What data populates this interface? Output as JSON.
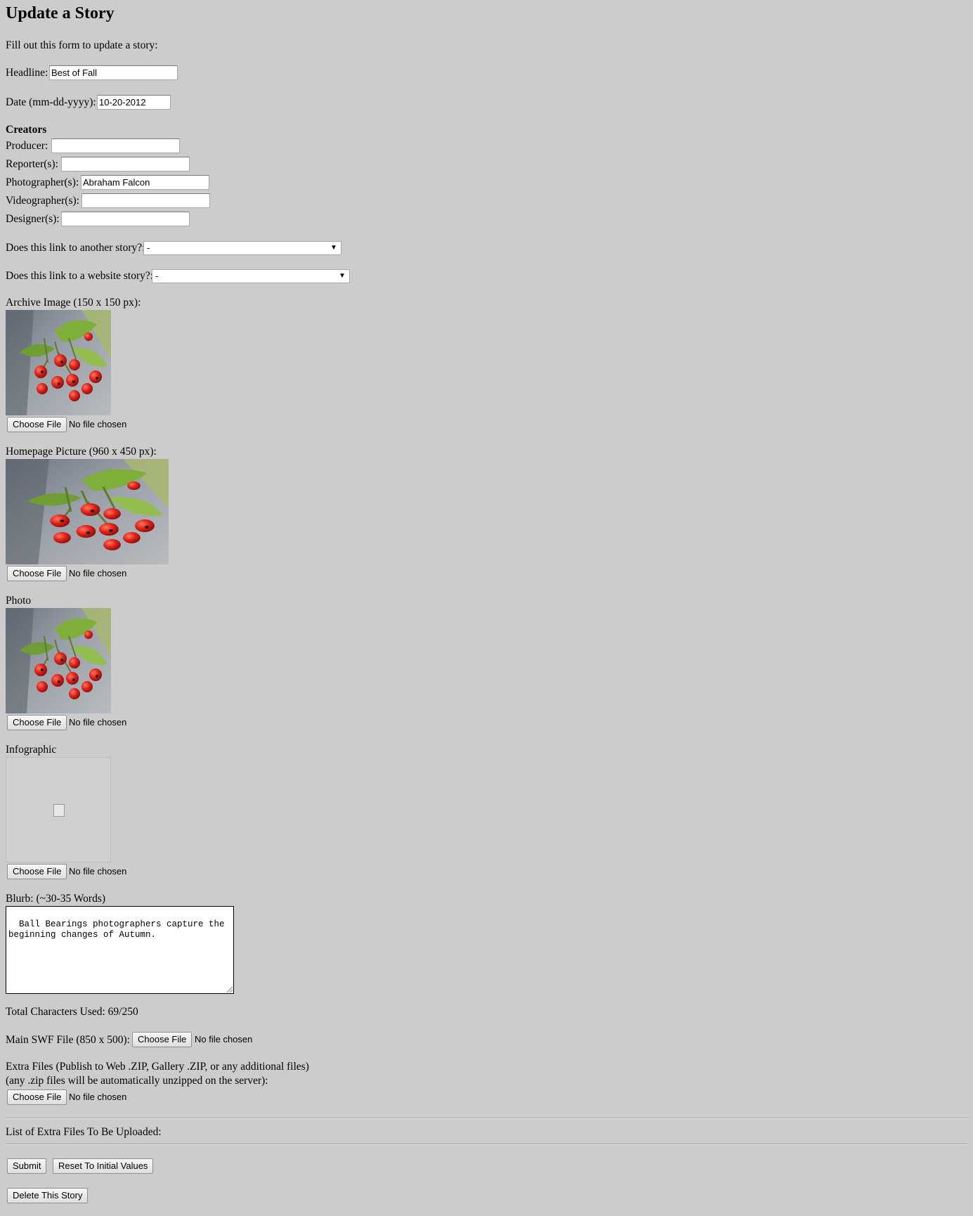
{
  "page": {
    "title": "Update a Story",
    "intro": "Fill out this form to update a story:"
  },
  "headline": {
    "label": "Headline:",
    "value": "Best of Fall"
  },
  "date": {
    "label": "Date (mm-dd-yyyy):",
    "value": "10-20-2012"
  },
  "creators": {
    "heading": "Creators",
    "producer": {
      "label": "Producer:",
      "value": ""
    },
    "reporters": {
      "label": "Reporter(s):",
      "value": ""
    },
    "photographers": {
      "label": "Photographer(s):",
      "value": "Abraham Falcon"
    },
    "videographers": {
      "label": "Videographer(s):",
      "value": ""
    },
    "designers": {
      "label": "Designer(s):",
      "value": ""
    }
  },
  "link_another": {
    "label": "Does this link to another story?:",
    "selected": "-"
  },
  "link_website": {
    "label": "Does this link to a website story?:",
    "selected": "-"
  },
  "file_input": {
    "button": "Choose File",
    "status": "No file chosen"
  },
  "archive_image": {
    "label": "Archive Image (150 x 150 px):",
    "image_icon": "berries-photo"
  },
  "homepage_picture": {
    "label": "Homepage Picture (960 x 450 px):",
    "image_icon": "berries-photo"
  },
  "photo": {
    "label": "Photo",
    "image_icon": "berries-photo"
  },
  "infographic": {
    "label": "Infographic",
    "image_icon": "broken-image-icon"
  },
  "blurb": {
    "label": "Blurb: (~30-35 Words)",
    "value": "Ball Bearings photographers capture the beginning changes of Autumn."
  },
  "char_count": {
    "text": "Total Characters Used: 69/250"
  },
  "main_swf": {
    "label": "Main SWF File (850 x 500):"
  },
  "extra_files": {
    "label_line1": "Extra Files (Publish to Web .ZIP, Gallery .ZIP, or any additional files)",
    "label_line2": "(any .zip files will be automatically unzipped on the server):"
  },
  "extra_list": {
    "label": "List of Extra Files To Be Uploaded:"
  },
  "actions": {
    "submit": "Submit",
    "reset": "Reset To Initial Values",
    "delete": "Delete This Story"
  },
  "colors": {
    "page_bg": "#cccccc",
    "berry_red": "#e8281c",
    "leaf_green": "#8fb84a"
  }
}
